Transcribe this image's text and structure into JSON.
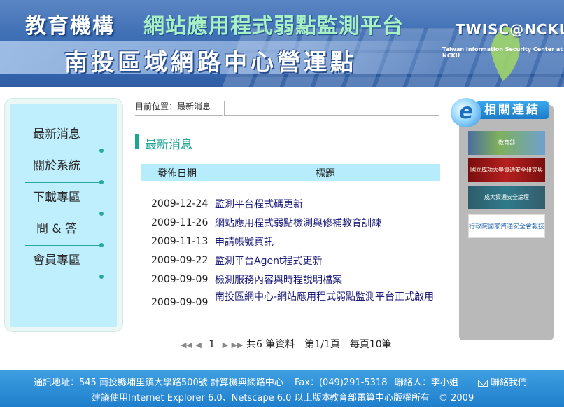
{
  "header": {
    "org": "教育機構",
    "platform": "網站應用程式弱點監測平台",
    "center": "南投區域網路中心營運點",
    "logo_text": "TWISC@NCKU",
    "logo_sub": "Taiwan Information Security Center at NCKU"
  },
  "nav": {
    "items": [
      {
        "label": "最新消息"
      },
      {
        "label": "關於系統"
      },
      {
        "label": "下載專區"
      },
      {
        "label": "問 & 答"
      },
      {
        "label": "會員專區"
      }
    ]
  },
  "breadcrumb": "目前位置：最新消息",
  "section_title": "最新消息",
  "table": {
    "headers": {
      "date": "發佈日期",
      "title": "標題"
    },
    "rows": [
      {
        "date": "2009-12-24",
        "title": "監測平台程式碼更新"
      },
      {
        "date": "2009-11-26",
        "title": "網站應用程式弱點檢測與修補教育訓練"
      },
      {
        "date": "2009-11-13",
        "title": "申請帳號資訊"
      },
      {
        "date": "2009-09-22",
        "title": "監測平台Agent程式更新"
      },
      {
        "date": "2009-09-09",
        "title": "檢測服務內容與時程說明檔案"
      },
      {
        "date": "2009-09-09",
        "title": "南投區網中心-網站應用程式弱點監測平台正式啟用"
      }
    ]
  },
  "pager": {
    "first": "◀◀",
    "prev": "◀",
    "page": "1",
    "next": "▶",
    "last": "▶▶",
    "summary": "共6 筆資料　第1/1頁　每頁10筆"
  },
  "links": {
    "title": "相關連結",
    "badge": "e",
    "banners": [
      {
        "label": "教育部"
      },
      {
        "label": "國立成功大學資通安全研究與教學中心"
      },
      {
        "label": "成大資通安全論壇"
      },
      {
        "label": "行政院國家資通安全會報技術服務中心"
      }
    ]
  },
  "footer": {
    "address": "通訊地址：545 南投縣埔里鎮大學路500號 計算機與網路中心",
    "fax": "Fax：(049)291-5318",
    "contact": "聯絡人：李小姐",
    "contact_us": "聯絡我們",
    "browser": "建議使用Internet Explorer 6.0、Netscape 6.0 以上版本",
    "copyright": "教育部電算中心版權所有　© 2009"
  },
  "colors": {
    "accent": "#1aa596",
    "header_blue": "#3f6fb5",
    "footer_blue": "#1f7fcc",
    "table_head": "#b6ecfb",
    "nav_bg": "#bfeefc"
  }
}
